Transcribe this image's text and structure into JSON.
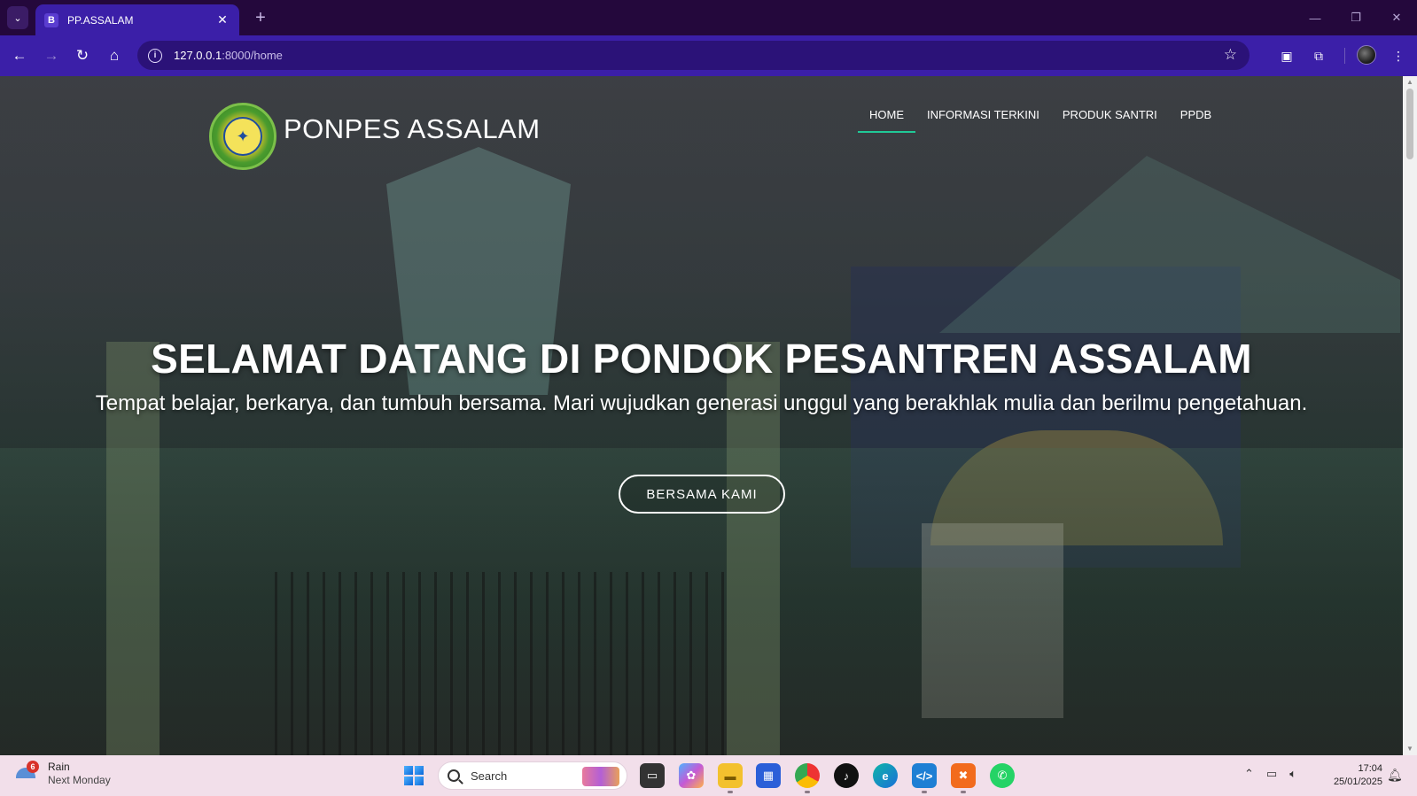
{
  "browser": {
    "tab_title": "PP.ASSALAM",
    "tab_favicon": "B",
    "url_host": "127.0.0.1",
    "url_path": ":8000/home"
  },
  "site": {
    "brand": "PONPES ASSALAM",
    "nav": [
      {
        "label": "HOME",
        "active": true
      },
      {
        "label": "INFORMASI TERKINI"
      },
      {
        "label": "PRODUK SANTRI"
      },
      {
        "label": "PPDB"
      }
    ],
    "hero": {
      "title": "SELAMAT DATANG DI PONDOK PESANTREN ASSALAM",
      "subtitle": "Tempat belajar, berkarya, dan tumbuh bersama. Mari wujudkan generasi unggul yang berakhlak mulia dan berilmu pengetahuan.",
      "cta": "BERSAMA KAMI"
    },
    "accent_color": "#20c997"
  },
  "taskbar": {
    "weather_title": "Rain",
    "weather_sub": "Next Monday",
    "weather_badge": "6",
    "search_label": "Search",
    "time": "17:04",
    "date": "25/01/2025"
  }
}
